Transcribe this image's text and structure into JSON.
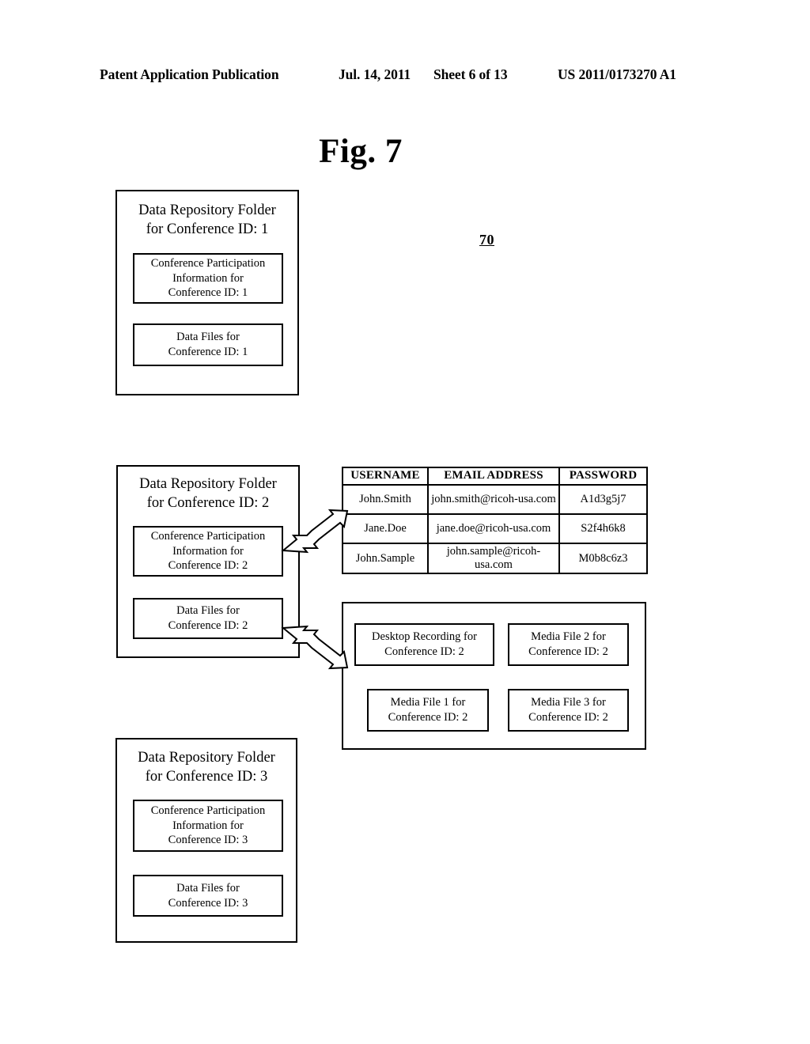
{
  "header": {
    "publication": "Patent Application Publication",
    "date": "Jul. 14, 2011",
    "sheet": "Sheet 6 of 13",
    "patent_number": "US 2011/0173270 A1"
  },
  "figure": {
    "title": "Fig. 7",
    "reference_numeral": "70"
  },
  "folders": [
    {
      "title": "Data Repository Folder\nfor Conference ID: 1",
      "title_line1": "Data Repository Folder",
      "title_line2": "for Conference ID: 1",
      "participation_box": "Conference Participation Information for Conference ID: 1",
      "participation_line1": "Conference Participation",
      "participation_line2": "Information for",
      "participation_line3": "Conference ID: 1",
      "datafiles_line1": "Data Files for",
      "datafiles_line2": "Conference ID: 1"
    },
    {
      "title_line1": "Data Repository Folder",
      "title_line2": "for Conference ID: 2",
      "participation_line1": "Conference Participation",
      "participation_line2": "Information for",
      "participation_line3": "Conference ID: 2",
      "datafiles_line1": "Data Files for",
      "datafiles_line2": "Conference ID: 2"
    },
    {
      "title_line1": "Data Repository Folder",
      "title_line2": "for Conference ID: 3",
      "participation_line1": "Conference Participation",
      "participation_line2": "Information for",
      "participation_line3": "Conference ID: 3",
      "datafiles_line1": "Data Files for",
      "datafiles_line2": "Conference ID: 3"
    }
  ],
  "credentials_table": {
    "columns": [
      "USERNAME",
      "EMAIL ADDRESS",
      "PASSWORD"
    ],
    "rows": [
      {
        "username": "John.Smith",
        "email": "john.smith@ricoh-usa.com",
        "password": "A1d3g5j7"
      },
      {
        "username": "Jane.Doe",
        "email": "jane.doe@ricoh-usa.com",
        "password": "S2f4h6k8"
      },
      {
        "username": "John.Sample",
        "email": "john.sample@ricoh-usa.com",
        "password": "M0b8c6z3"
      }
    ]
  },
  "datafiles_container": {
    "items": [
      {
        "line1": "Desktop Recording for",
        "line2": "Conference ID: 2"
      },
      {
        "line1": "Media File 2 for",
        "line2": "Conference ID: 2"
      },
      {
        "line1": "Media File 1 for",
        "line2": "Conference ID: 2"
      },
      {
        "line1": "Media File 3 for",
        "line2": "Conference ID: 2"
      }
    ]
  }
}
